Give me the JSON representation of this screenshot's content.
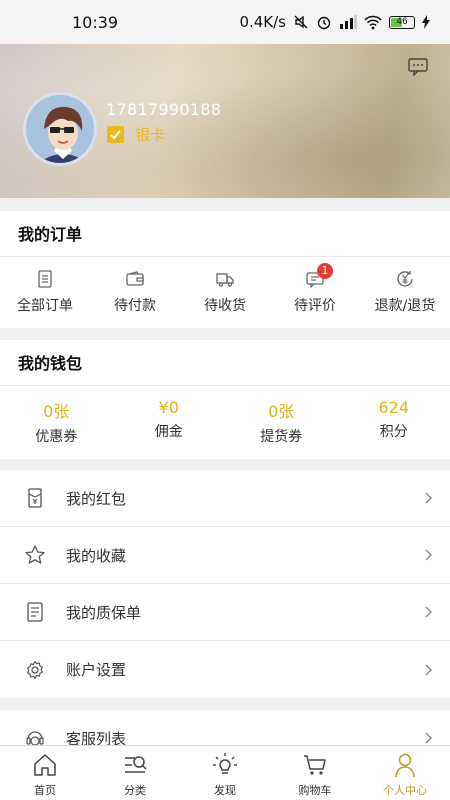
{
  "status": {
    "time": "10:39",
    "speed": "0.4K/s",
    "battery": "46"
  },
  "profile": {
    "phone": "17817990188",
    "level": "银卡"
  },
  "orders": {
    "title": "我的订单",
    "items": [
      {
        "label": "全部订单",
        "icon": "order-list-icon"
      },
      {
        "label": "待付款",
        "icon": "wallet-icon"
      },
      {
        "label": "待收货",
        "icon": "truck-icon"
      },
      {
        "label": "待评价",
        "icon": "comment-icon",
        "badge": "1"
      },
      {
        "label": "退款/退货",
        "icon": "refund-icon"
      }
    ]
  },
  "wallet": {
    "title": "我的钱包",
    "items": [
      {
        "value": "0张",
        "label": "优惠券"
      },
      {
        "value": "¥0",
        "label": "佣金"
      },
      {
        "value": "0张",
        "label": "提货券"
      },
      {
        "value": "624",
        "label": "积分"
      }
    ]
  },
  "menu": [
    {
      "label": "我的红包",
      "icon": "red-envelope-icon"
    },
    {
      "label": "我的收藏",
      "icon": "star-icon"
    },
    {
      "label": "我的质保单",
      "icon": "warranty-icon"
    },
    {
      "label": "账户设置",
      "icon": "gear-icon"
    }
  ],
  "menu2": [
    {
      "label": "客服列表",
      "icon": "customer-service-icon"
    }
  ],
  "tabs": [
    {
      "label": "首页",
      "icon": "home-icon"
    },
    {
      "label": "分类",
      "icon": "category-icon"
    },
    {
      "label": "发现",
      "icon": "discover-icon"
    },
    {
      "label": "购物车",
      "icon": "cart-icon"
    },
    {
      "label": "个人中心",
      "icon": "user-icon",
      "active": true
    }
  ],
  "colors": {
    "accent": "#e0b418",
    "badge": "#e83b36",
    "active_tab": "#c49a2c"
  }
}
